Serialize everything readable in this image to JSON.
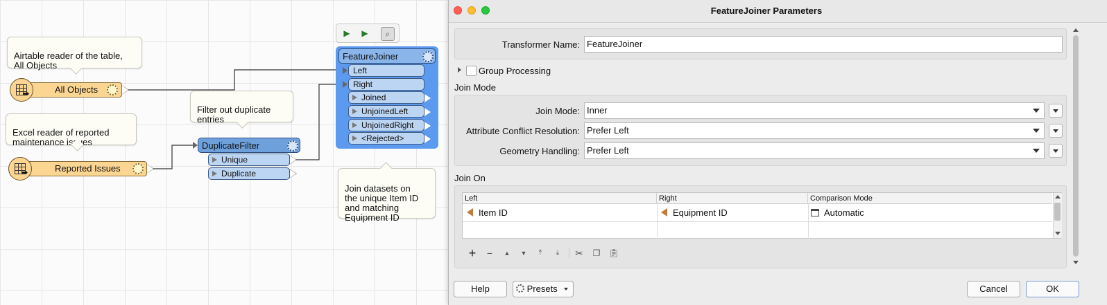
{
  "canvas": {
    "annotations": {
      "airtable_note": "Airtable reader of the table,\nAll Objects",
      "excel_note": "Excel reader of reported\nmaintenance issues",
      "filter_note": "Filter out duplicate\nentries",
      "join_note": "Join datasets on\nthe unique Item ID\nand matching\nEquipment ID"
    },
    "readers": {
      "all_objects": "All Objects",
      "reported_issues": "Reported Issues"
    },
    "duplicate_filter": {
      "title": "DuplicateFilter",
      "ports": [
        "Unique",
        "Duplicate"
      ]
    },
    "feature_joiner": {
      "title": "FeatureJoiner",
      "inputs": [
        "Left",
        "Right"
      ],
      "outputs": [
        "Joined",
        "UnjoinedLeft",
        "UnjoinedRight",
        "<Rejected>"
      ]
    }
  },
  "dialog": {
    "title": "FeatureJoiner Parameters",
    "transformer_name_label": "Transformer Name:",
    "transformer_name_value": "FeatureJoiner",
    "group_processing_label": "Group Processing",
    "join_mode_section": "Join Mode",
    "join_mode_label": "Join Mode:",
    "join_mode_value": "Inner",
    "conflict_label": "Attribute Conflict Resolution:",
    "conflict_value": "Prefer Left",
    "geometry_label": "Geometry Handling:",
    "geometry_value": "Prefer Left",
    "join_on_section": "Join On",
    "table": {
      "headers": [
        "Left",
        "Right",
        "Comparison Mode"
      ],
      "rows": [
        {
          "left": "Item ID",
          "right": "Equipment ID",
          "mode": "Automatic"
        }
      ]
    },
    "buttons": {
      "help": "Help",
      "presets": "Presets",
      "cancel": "Cancel",
      "ok": "OK"
    }
  }
}
